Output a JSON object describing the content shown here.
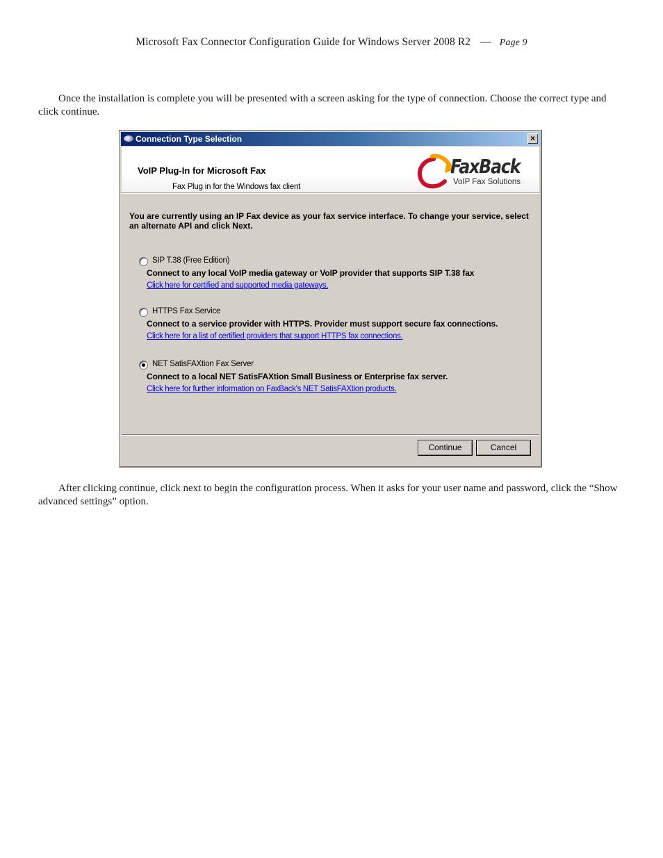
{
  "header": {
    "title": "Microsoft Fax Connector Configuration Guide for Windows Server 2008 R2",
    "dash": "—",
    "page": "Page 9"
  },
  "paragraphs": {
    "intro": "Once the installation is complete you will be presented with a screen asking for the type of connection.  Choose the correct type and click continue.",
    "after": "After clicking continue, click next to begin the configuration process.  When it asks for your user name and password, click the “Show advanced settings” option."
  },
  "dialog": {
    "title": "Connection Type Selection",
    "close_glyph": "×",
    "banner": {
      "title": "VoIP Plug-In for Microsoft Fax",
      "subtitle": "Fax Plug in for the Windows fax client",
      "logo_brand": "FaxBack",
      "logo_tagline": "VoIP Fax Solutions"
    },
    "intro": "You are currently using an IP Fax device as your fax service interface.  To change your service, select an alternate API and click Next.",
    "options": [
      {
        "label": "SIP T.38 (Free Edition)",
        "description": "Connect to any local VoIP media gateway or VoIP provider that supports SIP T.38 fax",
        "link": "Click here for certified and supported media gateways.",
        "selected": false
      },
      {
        "label": "HTTPS Fax Service",
        "description": "Connect to a service provider with HTTPS.  Provider must support secure fax connections.",
        "link": "Click here for a list of certified providers that support HTTPS fax connections.",
        "selected": false
      },
      {
        "label": "NET SatisFAXtion Fax Server",
        "description": "Connect to a local NET SatisFAXtion Small Business or Enterprise fax server.",
        "link": "Click here for further information on FaxBack's NET SatisFAXtion products.",
        "selected": true
      }
    ],
    "buttons": {
      "continue": "Continue",
      "cancel": "Cancel"
    }
  }
}
